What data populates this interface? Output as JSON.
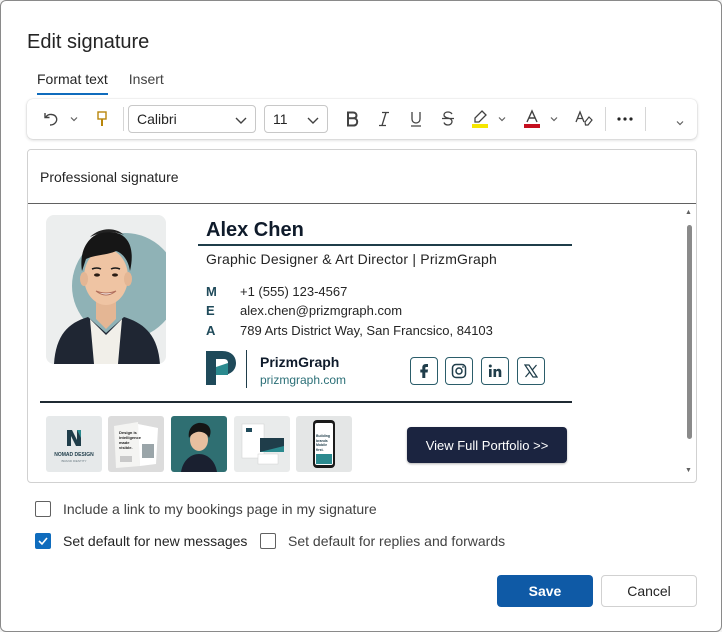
{
  "dialog": {
    "title": "Edit signature"
  },
  "tabs": [
    {
      "label": "Format text",
      "active": true
    },
    {
      "label": "Insert",
      "active": false
    }
  ],
  "toolbar": {
    "font_family": "Calibri",
    "font_size": "11",
    "highlight_color": "#f5e600",
    "font_color": "#c50f1f",
    "icons": [
      "undo-icon",
      "format-painter-icon",
      "bold-icon",
      "italic-icon",
      "underline-icon",
      "strikethrough-icon",
      "highlight-icon",
      "font-color-icon",
      "clear-formatting-icon",
      "more-options-icon"
    ]
  },
  "editor": {
    "signature_name": "Professional signature"
  },
  "signature": {
    "name": "Alex Chen",
    "role": "Graphic Designer & Art Director | PrizmGraph",
    "contacts": [
      {
        "label": "M",
        "value": "+1 (555) 123-4567"
      },
      {
        "label": "E",
        "value": "alex.chen@prizmgraph.com"
      },
      {
        "label": "A",
        "value": "789 Arts District Way, San Francsico, 84103"
      }
    ],
    "brand": {
      "name": "PrizmGraph",
      "url": "prizmgraph.com"
    },
    "social": [
      "facebook-icon",
      "instagram-icon",
      "linkedin-icon",
      "x-icon"
    ],
    "thumbnails": {
      "nomad": {
        "title": "NOMAD DESIGN",
        "subtitle": "BRAND IDENTITY"
      },
      "brochure": "Design is intelligence made visible.",
      "phone": "Building brands Mobile first."
    },
    "portfolio_button": "View Full Portfolio >>",
    "accent": "#1f3d4a",
    "button_bg": "#1b2440"
  },
  "options": {
    "bookings_link": {
      "label": "Include a link to my bookings page in my signature",
      "checked": false
    },
    "default_new": {
      "label": "Set default for new messages",
      "checked": true
    },
    "default_replies": {
      "label": "Set default for replies and forwards",
      "checked": false
    }
  },
  "actions": {
    "save": "Save",
    "cancel": "Cancel"
  }
}
